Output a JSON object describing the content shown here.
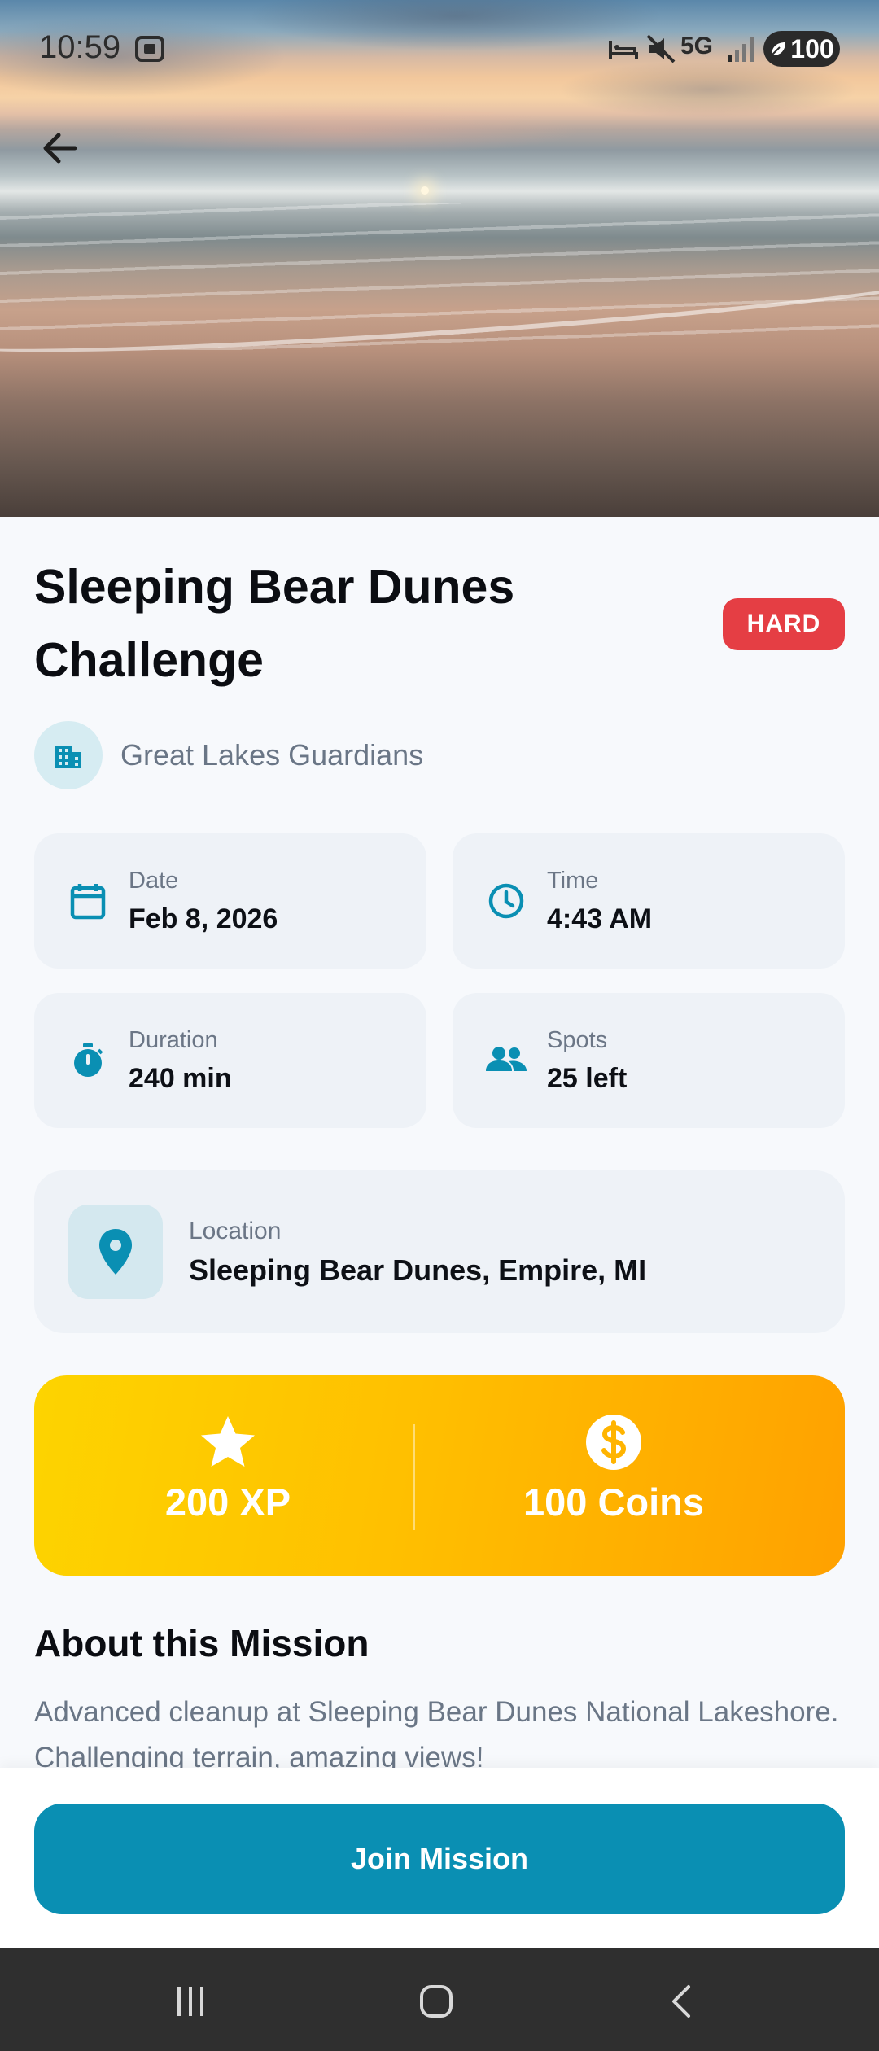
{
  "status_bar": {
    "time": "10:59",
    "network": "5G",
    "battery": "100"
  },
  "hero": {
    "image": "sunset-beach-photo"
  },
  "mission": {
    "title": "Sleeping Bear Dunes Challenge",
    "difficulty": "HARD",
    "organization": "Great Lakes Guardians",
    "details": {
      "date_label": "Date",
      "date_value": "Feb 8, 2026",
      "time_label": "Time",
      "time_value": "4:43 AM",
      "duration_label": "Duration",
      "duration_value": "240 min",
      "spots_label": "Spots",
      "spots_value": "25 left"
    },
    "location": {
      "label": "Location",
      "value": "Sleeping Bear Dunes, Empire, MI"
    },
    "rewards": {
      "xp": "200 XP",
      "coins": "100 Coins"
    },
    "about_title": "About this Mission",
    "about_text": "Advanced cleanup at Sleeping Bear Dunes National Lakeshore. Challenging terrain, amazing views!"
  },
  "actions": {
    "join_label": "Join Mission"
  },
  "colors": {
    "accent": "#0a8fb3",
    "hard_badge": "#e53e44",
    "reward_gradient_start": "#fdd400",
    "reward_gradient_end": "#ffa100"
  },
  "icons": {
    "back": "arrow-left-icon",
    "org": "building-icon",
    "date": "calendar-icon",
    "time": "clock-icon",
    "duration": "stopwatch-icon",
    "spots": "people-icon",
    "location": "map-pin-icon",
    "xp": "star-icon",
    "coins": "dollar-coin-icon"
  }
}
